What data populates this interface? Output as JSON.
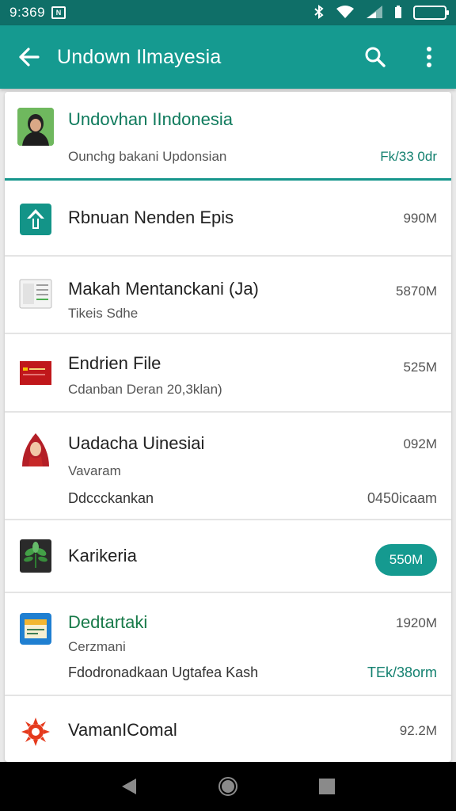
{
  "status_bar": {
    "time": "9:369",
    "notification_badge": "N",
    "icons": [
      "bluetooth-icon",
      "wifi-icon",
      "signal-icon",
      "battery-icon"
    ]
  },
  "app_bar": {
    "title": "Undown Ilmayesia",
    "icons": [
      "back-arrow-icon",
      "search-icon",
      "more-vert-icon"
    ]
  },
  "header": {
    "title": "Undovhan IIndonesia",
    "subtitle": "Ounchg bakani Updonsian",
    "size": "Fk/33 0dr"
  },
  "items": [
    {
      "name": "Rbnuan Nenden Epis",
      "size": "990M",
      "icon": "upload-arrow-icon"
    },
    {
      "name": "Makah Mentanckani (Ja)",
      "sub": "Tikeis Sdhe",
      "size": "5870M",
      "icon": "document-icon"
    },
    {
      "name": "Endrien File",
      "sub": "Cdanban Deran 20,3klan)",
      "size": "525M",
      "icon": "red-flag-icon"
    },
    {
      "name": "Uadacha Uinesiai",
      "sub": "Vavaram",
      "sub2": "Ddccckankan",
      "size": "092M",
      "size2": "0450icaam",
      "icon": "person-hijab-icon"
    },
    {
      "name": "Karikeria",
      "size": "550M",
      "icon": "plant-icon"
    },
    {
      "name": "Dedtartaki",
      "sub": "Cerzmani",
      "sub2": "Fdodronadkaan Ugtafea Kash",
      "size": "1920M",
      "size2": "TEk/38orm",
      "icon": "store-icon"
    },
    {
      "name": "VamanIComal",
      "size": "92.2M",
      "icon": "sun-gear-icon"
    }
  ],
  "colors": {
    "status_bar": "#0f6f68",
    "app_bar": "#159a90",
    "accent": "#16968c",
    "green_text": "#187a49"
  }
}
